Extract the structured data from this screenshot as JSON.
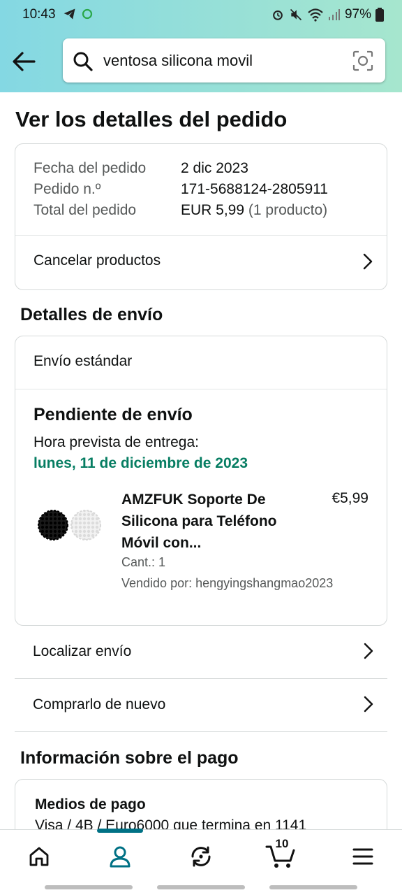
{
  "status_bar": {
    "time": "10:43",
    "battery": "97%"
  },
  "search": {
    "query": "ventosa silicona movil"
  },
  "page": {
    "title": "Ver los detalles del pedido"
  },
  "order_summary": {
    "date_label": "Fecha del pedido",
    "date_value": "2 dic 2023",
    "number_label": "Pedido n.º",
    "number_value": "171-5688124-2805911",
    "total_label": "Total del pedido",
    "total_value": "EUR 5,99",
    "total_sub": "(1 producto)",
    "cancel_label": "Cancelar productos"
  },
  "shipping": {
    "heading": "Detalles de envío",
    "method": "Envío estándar",
    "status": "Pendiente de envío",
    "eta_label": "Hora prevista de entrega:",
    "eta_date": "lunes, 11 de diciembre de 2023",
    "product": {
      "title": "AMZFUK Soporte De Silicona para Teléfono Móvil con...",
      "price": "€5,99",
      "qty": "Cant.: 1",
      "seller": "Vendido por: hengyingshangmao2023"
    },
    "track_label": "Localizar envío",
    "rebuy_label": "Comprarlo de nuevo"
  },
  "payment": {
    "heading": "Información sobre el pago",
    "methods_label": "Medios de pago",
    "methods_value": "Visa / 4B / Euro6000 que termina en 1141"
  },
  "bottom_nav": {
    "cart_count": "10",
    "icons": [
      "home-icon",
      "account-icon",
      "returns-icon",
      "cart-icon",
      "menu-icon"
    ],
    "accent": "#007185"
  },
  "colors": {
    "eta_green": "#067d62",
    "header_gradient_start": "#84d8e3",
    "header_gradient_end": "#a6e6ce"
  }
}
